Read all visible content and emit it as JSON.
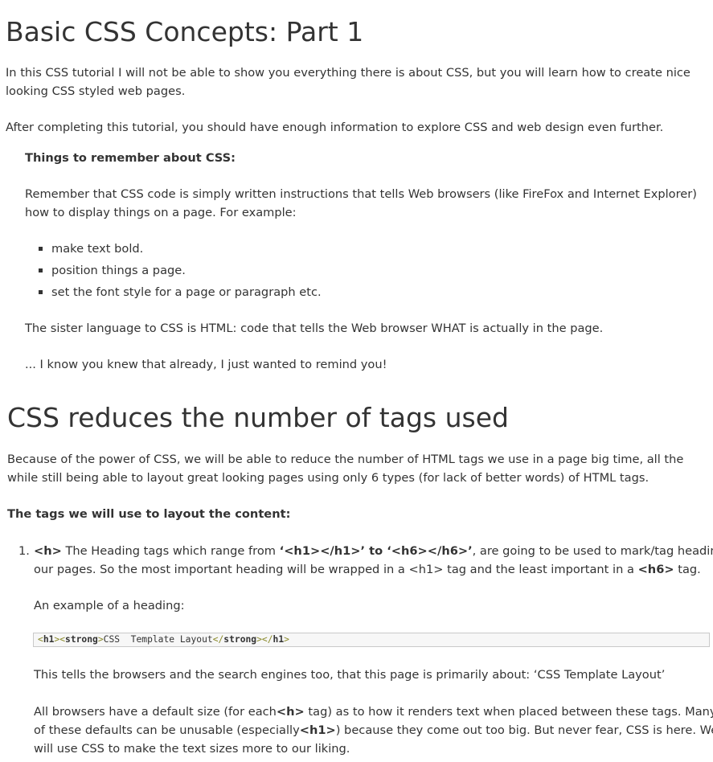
{
  "title": "Basic CSS Concepts: Part 1",
  "intro": {
    "p1_line1": "In this CSS tutorial I will not be able to show you everything there is about CSS, but you will learn how to create nice",
    "p1_line2": "looking CSS styled web pages.",
    "p2": "After completing this tutorial, you should have enough information to explore CSS and web design even further."
  },
  "callout": {
    "heading": "Things to remember about CSS:",
    "p1_line1": "Remember that CSS code is simply written instructions that tells Web browsers (like FireFox and Internet Explorer)",
    "p1_line2": "how to display things on a page. For example:",
    "bullets": [
      "make text bold.",
      "position things a page.",
      "set the font style for a page or paragraph etc."
    ],
    "p2": "The sister language to CSS is HTML: code that tells the Web browser WHAT is actually in the page.",
    "p3": "... I know you knew that already, I just wanted to remind you!"
  },
  "section2": {
    "heading": "CSS reduces the number of tags used",
    "p1_line1": "Because of the power of CSS, we will be able to reduce the number of HTML tags we use in a page big time, all the",
    "p1_line2": "while still being able to layout great looking pages using only 6 types (for lack of better words) of HTML tags.",
    "subheading": "The tags we will use to layout the content:",
    "list_number": "1.",
    "item1": {
      "l1_tag": "<h>",
      "l1_a": " The Heading tags which range from ",
      "l1_range1": "‘<h1></h1>’ to ‘<h6></h6>’",
      "l1_b": ", are going to be used to mark/tag headings in",
      "l2_a": "our pages. So the most important heading will be wrapped in a <h1> tag and the least important in a ",
      "l2_tag": "<h6>",
      "l2_b": " tag.",
      "example_label": "An example of a heading:",
      "code": {
        "open1": "<",
        "h1": "h1",
        "close1": "><",
        "strong": "strong",
        "close2": ">",
        "text": "CSS  Template Layout",
        "open2": "</",
        "strong_end": "strong",
        "close3": "></",
        "h1_end": "h1",
        "close4": ">"
      },
      "tells": "This tells the browsers and the search engines too, that this page is primarily about: ‘CSS Template Layout’",
      "all_l1_a": "All browsers have a default size (for each",
      "all_l1_tag": "<h>",
      "all_l1_b": " tag) as to how it renders text when placed between these tags. Many",
      "all_l2_a": "of these defaults can be unusable (especially",
      "all_l2_tag": "<h1>",
      "all_l2_b": ") because they come out too big. But never fear, CSS is here. We",
      "all_l3": "will use CSS to make the text sizes more to our liking."
    }
  },
  "colors": {
    "text": "#333333",
    "code_background": "#f7f7f7",
    "code_border": "#c9c9c9",
    "code_tag": "#8a8a2a"
  }
}
